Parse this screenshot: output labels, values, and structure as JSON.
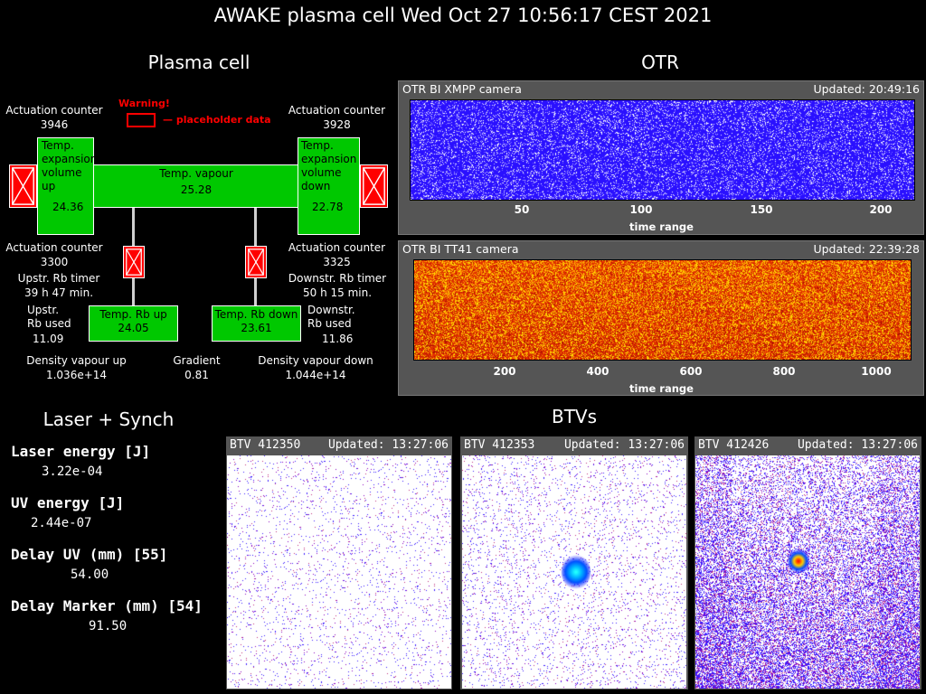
{
  "title": "AWAKE plasma cell Wed Oct 27 10:56:17 CEST 2021",
  "plasma": {
    "heading": "Plasma cell",
    "warning": "Warning!",
    "placeholder_note": "— placeholder data",
    "act_tl_label": "Actuation counter",
    "act_tl_value": "3946",
    "act_tr_label": "Actuation counter",
    "act_tr_value": "3928",
    "act_bl_label": "Actuation counter",
    "act_bl_value": "3300",
    "act_br_label": "Actuation counter",
    "act_br_value": "3325",
    "exp_up_label": "Temp.\nexpansion\nvolume\nup",
    "exp_up_value": "24.36",
    "exp_down_label": "Temp.\nexpansion\nvolume\ndown",
    "exp_down_value": "22.78",
    "vapour_label": "Temp. vapour",
    "vapour_value": "25.28",
    "rb_up_label": "Temp. Rb up",
    "rb_up_value": "24.05",
    "rb_down_label": "Temp. Rb down",
    "rb_down_value": "23.61",
    "up_timer_label": "Upstr. Rb timer",
    "up_timer_value": "39 h 47 min.",
    "down_timer_label": "Downstr. Rb timer",
    "down_timer_value": "50 h 15 min.",
    "up_used_label": "Upstr.\nRb used",
    "up_used_value": "11.09",
    "down_used_label": "Downstr.\nRb used",
    "down_used_value": "11.86",
    "dens_up_label": "Density vapour up",
    "dens_up_value": "1.036e+14",
    "gradient_label": "Gradient",
    "gradient_value": "0.81",
    "dens_down_label": "Density vapour down",
    "dens_down_value": "1.044e+14"
  },
  "otr": {
    "heading": "OTR",
    "cameras": [
      {
        "name": "OTR BI XMPP camera",
        "updated": "Updated: 20:49:16",
        "xlabel": "time range",
        "ticks": [
          "50",
          "100",
          "150",
          "200"
        ],
        "colormap": "blue"
      },
      {
        "name": "OTR BI TT41 camera",
        "updated": "Updated: 22:39:28",
        "xlabel": "time range",
        "ticks": [
          "200",
          "400",
          "600",
          "800",
          "1000"
        ],
        "colormap": "heat"
      }
    ]
  },
  "laser": {
    "heading": "Laser + Synch",
    "items": [
      {
        "label": "Laser energy [J]",
        "value": "3.22e-04"
      },
      {
        "label": "UV energy [J]",
        "value": "2.44e-07"
      },
      {
        "label": "Delay UV (mm) [55]",
        "value": "54.00"
      },
      {
        "label": "Delay Marker (mm) [54]",
        "value": "91.50"
      }
    ]
  },
  "btvs": {
    "heading": "BTVs",
    "screens": [
      {
        "name": "BTV 412350",
        "updated": "Updated: 13:27:06"
      },
      {
        "name": "BTV 412353",
        "updated": "Updated: 13:27:06"
      },
      {
        "name": "BTV 412426",
        "updated": "Updated: 13:27:06"
      }
    ]
  },
  "colors": {
    "green": "#00c800",
    "red": "#ff0000",
    "blue_bg": "#2a10ff",
    "heat_bg": "#e03000"
  }
}
